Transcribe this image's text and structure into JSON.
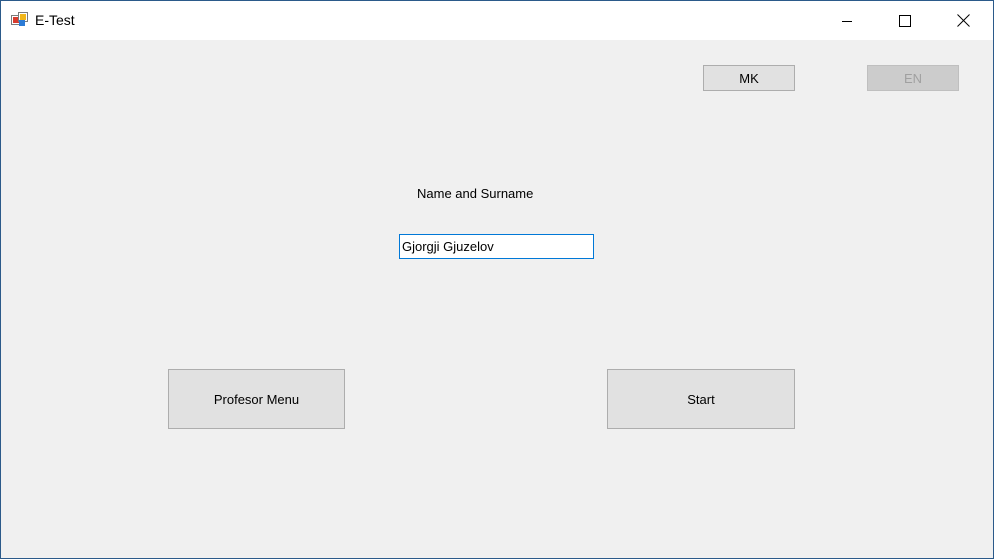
{
  "window": {
    "title": "E-Test",
    "icon": "winforms-app-icon",
    "controls": {
      "minimize": "minimize-icon",
      "maximize": "maximize-icon",
      "close": "close-icon"
    }
  },
  "language": {
    "mk_label": "MK",
    "en_label": "EN",
    "en_state": "disabled"
  },
  "form": {
    "name_label": "Name and Surname",
    "name_value": "Gjorgji Gjuzelov"
  },
  "actions": {
    "profesor_label": "Profesor Menu",
    "start_label": "Start"
  },
  "colors": {
    "window_border": "#2b5a8a",
    "client_bg": "#f0f0f0",
    "button_bg": "#e1e1e1",
    "button_border": "#adadad",
    "focus_border": "#0078d7"
  }
}
